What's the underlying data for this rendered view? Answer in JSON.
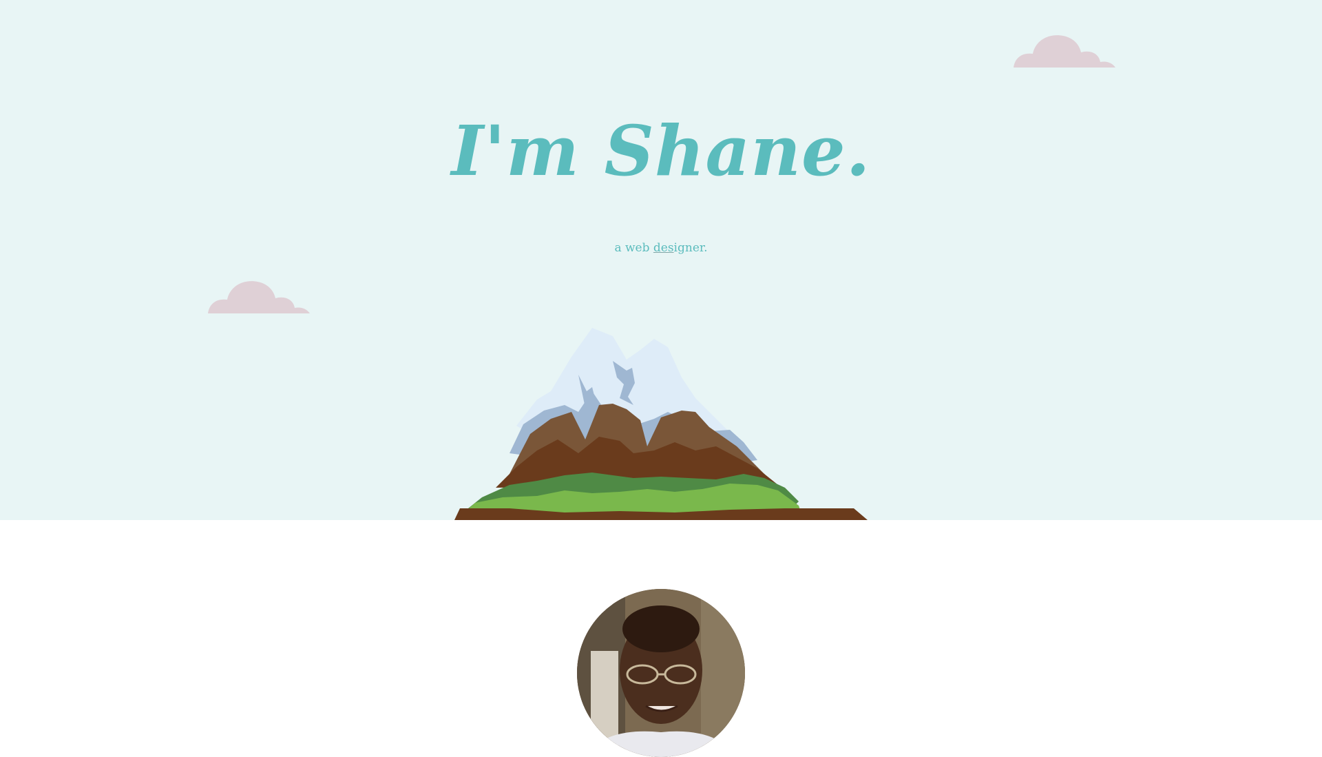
{
  "hero": {
    "title": "I'm Shane.",
    "tagline_prefix": "a web ",
    "tagline_underlined": "des",
    "tagline_suffix": "igner.",
    "background_color": "#e8f5f5",
    "text_color": "#5bbcbd"
  },
  "decor": {
    "cloud_color": "#dfd0d6",
    "icons": [
      "cloud-icon",
      "cloud-icon",
      "mountain-illustration"
    ]
  },
  "profile": {
    "avatar_icon": "avatar"
  }
}
